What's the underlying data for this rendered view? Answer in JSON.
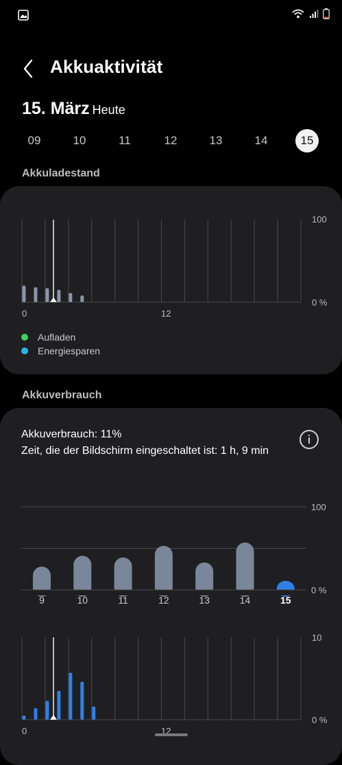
{
  "status": {
    "icons": [
      "gallery-icon",
      "wifi-icon",
      "signal-icon",
      "battery-icon"
    ]
  },
  "header": {
    "title": "Akkuaktivität"
  },
  "date": {
    "day": "15. März",
    "label": "Heute"
  },
  "days": [
    "09",
    "10",
    "11",
    "12",
    "13",
    "14",
    "15"
  ],
  "selected_day": "15",
  "level_section": {
    "label": "Akkuladestand",
    "legend": [
      {
        "label": "Aufladen",
        "color": "#3ecf5e"
      },
      {
        "label": "Energiesparen",
        "color": "#27b5e8"
      }
    ]
  },
  "usage_section": {
    "label": "Akkuverbrauch",
    "usage_line": "Akkuverbrauch: 11%",
    "screen_line": "Zeit, die der Bildschirm eingeschaltet ist: 1 h, 9 min"
  },
  "chart_data": [
    {
      "type": "bar",
      "name": "Akkuladestand",
      "x_tick_labels": [
        "0",
        "12"
      ],
      "y_tick_labels": [
        "100",
        "0 %"
      ],
      "ylim": [
        0,
        100
      ],
      "x": [
        0,
        0.5,
        1,
        1.5,
        2,
        2.5,
        3
      ],
      "values": [
        20,
        18,
        17,
        15,
        11,
        8,
        0
      ],
      "color": "#8a95a8",
      "current_time_marker": 3.5
    },
    {
      "type": "bar",
      "name": "Akkuverbrauch",
      "categories": [
        "9",
        "10",
        "11",
        "12",
        "13",
        "14",
        "15"
      ],
      "values": [
        28,
        41,
        39,
        53,
        33,
        57,
        11
      ],
      "highlight_color": "#2f7fe6",
      "color": "#7a869a",
      "y_tick_labels": [
        "100",
        "0 %"
      ],
      "ylim": [
        0,
        100
      ]
    },
    {
      "type": "bar",
      "name": "Akkuverbrauch (Stunden)",
      "x_tick_labels": [
        "0",
        "12"
      ],
      "y_tick_labels": [
        "10",
        "0 %"
      ],
      "ylim": [
        0,
        10
      ],
      "x": [
        0,
        0.5,
        1,
        1.5,
        2,
        2.5,
        3
      ],
      "values": [
        0.5,
        1.4,
        2.3,
        3.5,
        5.7,
        4.6,
        1.6
      ],
      "color": "#2f7fe6"
    }
  ]
}
